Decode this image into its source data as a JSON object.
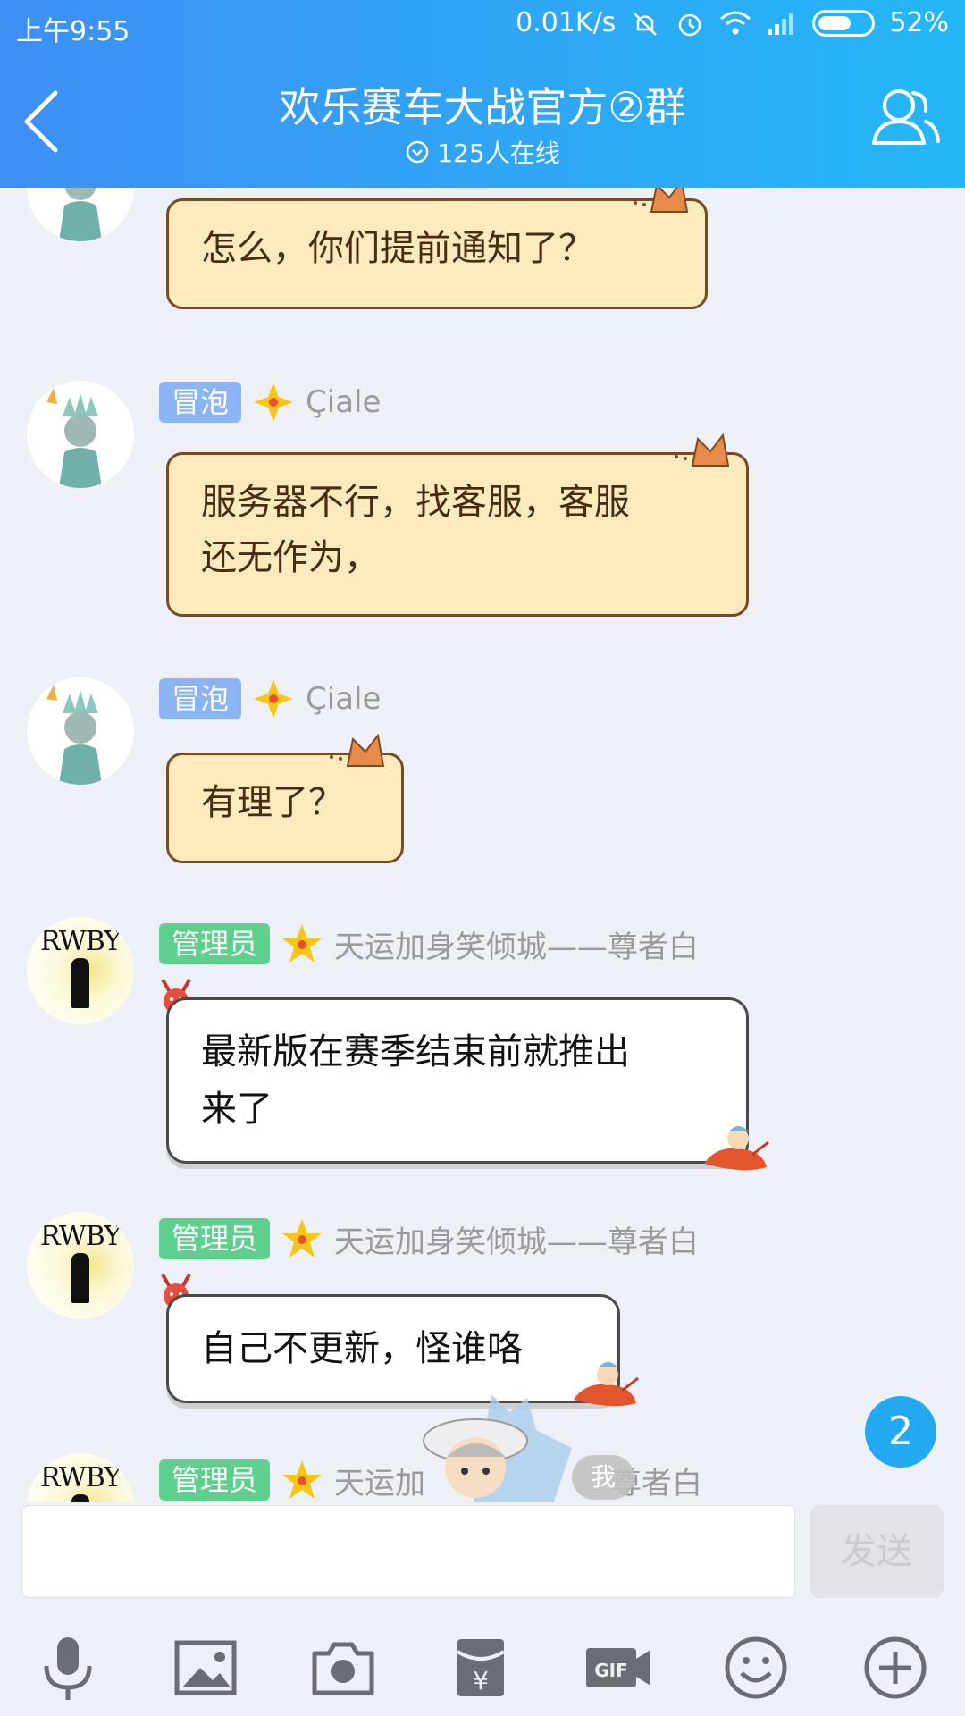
{
  "status_bar": {
    "time": "上午9:55",
    "speed": "0.01K/s",
    "battery": "52%"
  },
  "header": {
    "title": "欢乐赛车大战官方②群",
    "online": "125人在线"
  },
  "messages": [
    {
      "text": "怎么，你们提前通知了？"
    },
    {
      "badge": "冒泡",
      "sender": "Çiale",
      "lines": [
        "服务器不行，找客服，客服",
        "还无作为，"
      ]
    },
    {
      "badge": "冒泡",
      "sender": "Çiale",
      "text": "有理了？"
    },
    {
      "badge": "管理员",
      "sender": "天运加身笑倾城——尊者白",
      "lines": [
        "最新版在赛季结束前就推出",
        "来了"
      ]
    },
    {
      "badge": "管理员",
      "sender": "天运加身笑倾城——尊者白",
      "text": "自己不更新，怪谁咯"
    },
    {
      "badge": "管理员",
      "sender_a": "天运加",
      "sender_b": "尊者白"
    }
  ],
  "avatar_text": "RWBY",
  "unread_count": "2",
  "me_tag": "我",
  "input": {
    "send_label": "发送",
    "placeholder": ""
  },
  "toolbar": [
    "mic-icon",
    "image-icon",
    "camera-icon",
    "red-packet-icon",
    "gif-icon",
    "emoji-icon",
    "plus-icon"
  ],
  "colors": {
    "header_start": "#3d8ff3",
    "header_end": "#24b7f7",
    "badge_bubble": "#8ab4f4",
    "badge_admin": "#5fcf8e",
    "cat_bubble": "#fdebbd",
    "unread": "#23a9f2"
  }
}
